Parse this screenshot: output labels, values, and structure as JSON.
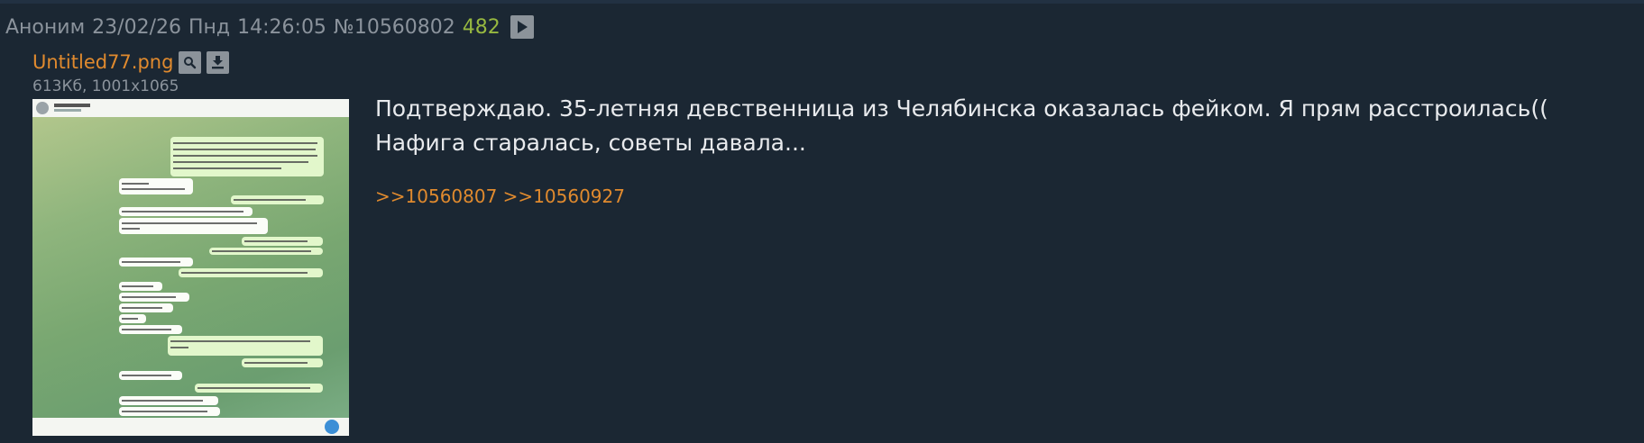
{
  "post": {
    "author": "Аноним",
    "date": "23/02/26",
    "weekday": "Пнд",
    "time": "14:26:05",
    "number": "№10560802",
    "reply_count": "482",
    "play_icon": "play-icon"
  },
  "file": {
    "name": "Untitled77.png",
    "search_icon": "magnifier-icon",
    "download_icon": "download-icon",
    "meta": "613Кб, 1001x1065"
  },
  "comment": {
    "text": "Подтверждаю. 35-летняя девственница из Челябинска оказалась фейком. Я прям расстроилась(( Нафига старалась, советы давала..."
  },
  "replies": [
    ">>10560807",
    ">>10560927"
  ],
  "colors": {
    "background": "#1b2733",
    "header_text": "#8b939c",
    "link": "#e08a2e",
    "reply_count": "#97b840",
    "body_text": "#e8eaed"
  }
}
